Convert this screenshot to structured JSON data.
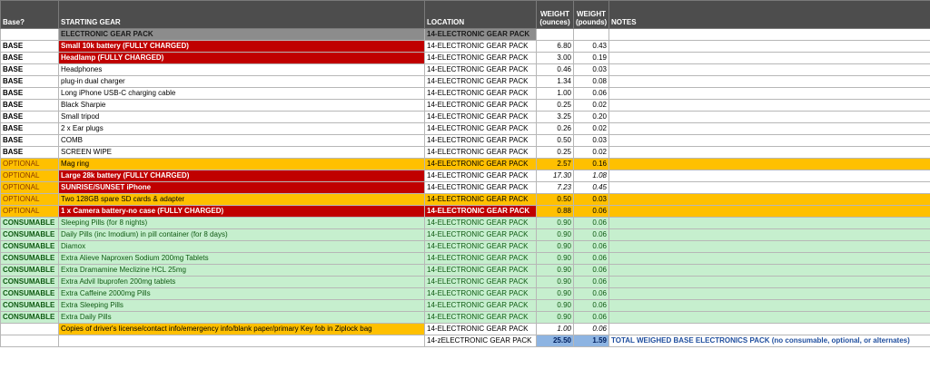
{
  "headers": {
    "base": "Base?",
    "gear": "STARTING GEAR",
    "location": "LOCATION",
    "weight_oz": "WEIGHT (ounces)",
    "weight_lb": "WEIGHT (pounds)",
    "notes": "NOTES"
  },
  "section": {
    "gear": "ELECTRONIC GEAR PACK",
    "location": "14-ELECTRONIC GEAR PACK"
  },
  "rows": [
    {
      "base": "BASE",
      "gear": "Small 10k battery (FULLY CHARGED)",
      "location": "14-ELECTRONIC GEAR PACK",
      "oz": "6.80",
      "lb": "0.43"
    },
    {
      "base": "BASE",
      "gear": "Headlamp (FULLY CHARGED)",
      "location": "14-ELECTRONIC GEAR PACK",
      "oz": "3.00",
      "lb": "0.19"
    },
    {
      "base": "BASE",
      "gear": "Headphones",
      "location": "14-ELECTRONIC GEAR PACK",
      "oz": "0.46",
      "lb": "0.03"
    },
    {
      "base": "BASE",
      "gear": "plug-in dual charger",
      "location": "14-ELECTRONIC GEAR PACK",
      "oz": "1.34",
      "lb": "0.08"
    },
    {
      "base": "BASE",
      "gear": "Long iPhone USB-C charging cable",
      "location": "14-ELECTRONIC GEAR PACK",
      "oz": "1.00",
      "lb": "0.06"
    },
    {
      "base": "BASE",
      "gear": "Black Sharpie",
      "location": "14-ELECTRONIC GEAR PACK",
      "oz": "0.25",
      "lb": "0.02"
    },
    {
      "base": "BASE",
      "gear": "Small tripod",
      "location": "14-ELECTRONIC GEAR PACK",
      "oz": "3.25",
      "lb": "0.20"
    },
    {
      "base": "BASE",
      "gear": "2 x Ear plugs",
      "location": "14-ELECTRONIC GEAR PACK",
      "oz": "0.26",
      "lb": "0.02"
    },
    {
      "base": "BASE",
      "gear": "COMB",
      "location": "14-ELECTRONIC GEAR PACK",
      "oz": "0.50",
      "lb": "0.03"
    },
    {
      "base": "BASE",
      "gear": "SCREEN WIPE",
      "location": "14-ELECTRONIC GEAR PACK",
      "oz": "0.25",
      "lb": "0.02"
    },
    {
      "base": "OPTIONAL",
      "gear": "Mag ring",
      "location": "14-ELECTRONIC GEAR PACK",
      "oz": "2.57",
      "lb": "0.16"
    },
    {
      "base": "OPTIONAL",
      "gear": "Large 28k battery  (FULLY CHARGED)",
      "location": "14-ELECTRONIC GEAR PACK",
      "oz": "17.30",
      "lb": "1.08"
    },
    {
      "base": "OPTIONAL",
      "gear": "SUNRISE/SUNSET iPhone",
      "location": "14-ELECTRONIC GEAR PACK",
      "oz": "7.23",
      "lb": "0.45"
    },
    {
      "base": "OPTIONAL",
      "gear": "Two 128GB spare SD cards & adapter",
      "location": "14-ELECTRONIC GEAR PACK",
      "oz": "0.50",
      "lb": "0.03"
    },
    {
      "base": "OPTIONAL",
      "gear": "1 x Camera battery-no case (FULLY CHARGED)",
      "location": "14-ELECTRONIC GEAR PACK",
      "oz": "0.88",
      "lb": "0.06"
    },
    {
      "base": "CONSUMABLE",
      "gear": "Sleeping Pills (for 8 nights)",
      "location": "14-ELECTRONIC GEAR PACK",
      "oz": "0.90",
      "lb": "0.06"
    },
    {
      "base": "CONSUMABLE",
      "gear": "Daily Pills (inc Imodium) in pill container (for 8 days)",
      "location": "14-ELECTRONIC GEAR PACK",
      "oz": "0.90",
      "lb": "0.06"
    },
    {
      "base": "CONSUMABLE",
      "gear": "Diamox",
      "location": "14-ELECTRONIC GEAR PACK",
      "oz": "0.90",
      "lb": "0.06"
    },
    {
      "base": "CONSUMABLE",
      "gear": "Extra Alieve Naproxen Sodium 200mg Tablets",
      "location": "14-ELECTRONIC GEAR PACK",
      "oz": "0.90",
      "lb": "0.06"
    },
    {
      "base": "CONSUMABLE",
      "gear": "Extra Dramamine Meclizine HCL 25mg",
      "location": "14-ELECTRONIC GEAR PACK",
      "oz": "0.90",
      "lb": "0.06"
    },
    {
      "base": "CONSUMABLE",
      "gear": "Extra Advil Ibuprofen 200mg tablets",
      "location": "14-ELECTRONIC GEAR PACK",
      "oz": "0.90",
      "lb": "0.06"
    },
    {
      "base": "CONSUMABLE",
      "gear": "Extra Caffeine 2000mg Pills",
      "location": "14-ELECTRONIC GEAR PACK",
      "oz": "0.90",
      "lb": "0.06"
    },
    {
      "base": "CONSUMABLE",
      "gear": "Extra Sleeping Pills",
      "location": "14-ELECTRONIC GEAR PACK",
      "oz": "0.90",
      "lb": "0.06"
    },
    {
      "base": "CONSUMABLE",
      "gear": "Extra Daily Pills",
      "location": "14-ELECTRONIC GEAR PACK",
      "oz": "0.90",
      "lb": "0.06"
    },
    {
      "base": "",
      "gear": "Copies of driver's license/contact info/emergency info/blank paper/primary Key fob in Ziplock bag",
      "location": "14-ELECTRONIC GEAR PACK",
      "oz": "1.00",
      "lb": "0.06"
    }
  ],
  "total": {
    "location": "14-zELECTRONIC GEAR PACK",
    "oz": "25.50",
    "lb": "1.59",
    "note": "TOTAL WEIGHED BASE ELECTRONICS PACK (no consumable, optional, or alternates)"
  },
  "colors": {
    "header_bg": "#4d4d4d",
    "section_bg": "#8c8c8c",
    "red_fill": "#c00000",
    "orange_fill": "#ffc000",
    "green_fill": "#c6efce",
    "total_blue": "#8db4e2"
  }
}
